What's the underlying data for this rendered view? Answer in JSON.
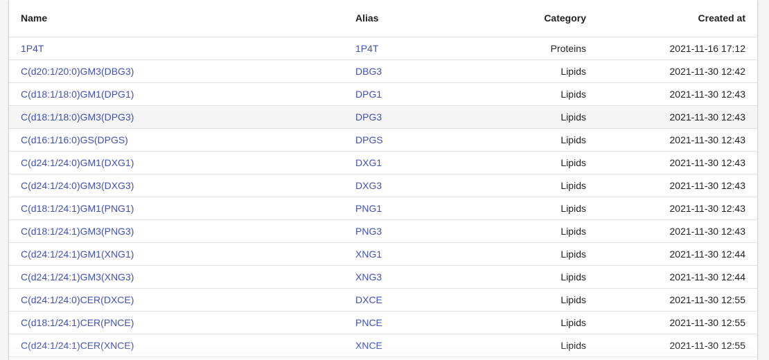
{
  "table": {
    "headers": {
      "name": "Name",
      "alias": "Alias",
      "category": "Category",
      "created_at": "Created at"
    },
    "rows": [
      {
        "name": "1P4T",
        "alias": "1P4T",
        "category": "Proteins",
        "created_at": "2021-11-16 17:12"
      },
      {
        "name": "C(d20:1/20:0)GM3(DBG3)",
        "alias": "DBG3",
        "category": "Lipids",
        "created_at": "2021-11-30 12:42"
      },
      {
        "name": "C(d18:1/18:0)GM1(DPG1)",
        "alias": "DPG1",
        "category": "Lipids",
        "created_at": "2021-11-30 12:43"
      },
      {
        "name": "C(d18:1/18:0)GM3(DPG3)",
        "alias": "DPG3",
        "category": "Lipids",
        "created_at": "2021-11-30 12:43"
      },
      {
        "name": "C(d16:1/16:0)GS(DPGS)",
        "alias": "DPGS",
        "category": "Lipids",
        "created_at": "2021-11-30 12:43"
      },
      {
        "name": "C(d24:1/24:0)GM1(DXG1)",
        "alias": "DXG1",
        "category": "Lipids",
        "created_at": "2021-11-30 12:43"
      },
      {
        "name": "C(d24:1/24:0)GM3(DXG3)",
        "alias": "DXG3",
        "category": "Lipids",
        "created_at": "2021-11-30 12:43"
      },
      {
        "name": "C(d18:1/24:1)GM1(PNG1)",
        "alias": "PNG1",
        "category": "Lipids",
        "created_at": "2021-11-30 12:43"
      },
      {
        "name": "C(d18:1/24:1)GM3(PNG3)",
        "alias": "PNG3",
        "category": "Lipids",
        "created_at": "2021-11-30 12:43"
      },
      {
        "name": "C(d24:1/24:1)GM1(XNG1)",
        "alias": "XNG1",
        "category": "Lipids",
        "created_at": "2021-11-30 12:44"
      },
      {
        "name": "C(d24:1/24:1)GM3(XNG3)",
        "alias": "XNG3",
        "category": "Lipids",
        "created_at": "2021-11-30 12:44"
      },
      {
        "name": "C(d24:1/24:0)CER(DXCE)",
        "alias": "DXCE",
        "category": "Lipids",
        "created_at": "2021-11-30 12:55"
      },
      {
        "name": "C(d18:1/24:1)CER(PNCE)",
        "alias": "PNCE",
        "category": "Lipids",
        "created_at": "2021-11-30 12:55"
      },
      {
        "name": "C(d24:1/24:1)CER(XNCE)",
        "alias": "XNCE",
        "category": "Lipids",
        "created_at": "2021-11-30 12:55"
      }
    ]
  },
  "colors": {
    "link": "#3f51b5",
    "text": "#212121",
    "divider": "#e0e0e0",
    "hover_row": "#f5f5f5"
  }
}
